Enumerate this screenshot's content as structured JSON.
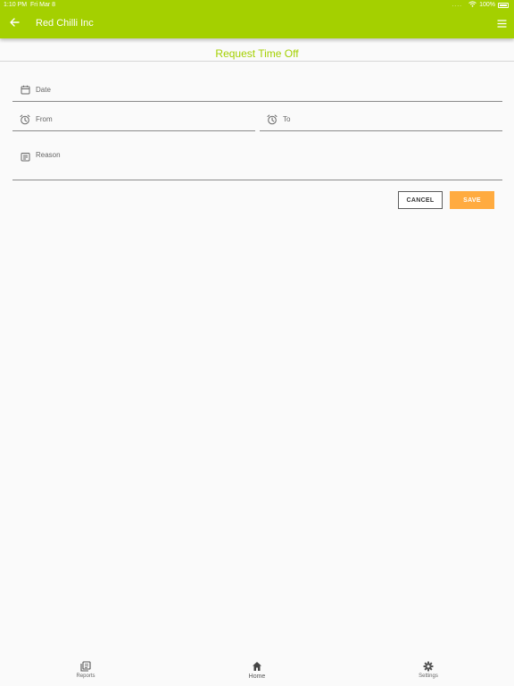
{
  "status_bar": {
    "time": "1:10 PM",
    "date": "Fri Mar 8",
    "dots": "....",
    "battery": "100%"
  },
  "app_bar": {
    "title": "Red Chilli Inc",
    "back_icon": "arrow-left-icon",
    "menu_icon": "hamburger-menu-icon",
    "color": "#a4d000"
  },
  "page": {
    "title": "Request Time Off",
    "title_color": "#a4d000"
  },
  "form": {
    "date_label": "Date",
    "from_label": "From",
    "to_label": "To",
    "reason_label": "Reason"
  },
  "actions": {
    "cancel_label": "CANCEL",
    "save_label": "SAVE",
    "save_color": "#ffab40"
  },
  "bottom_nav": {
    "tabs": [
      {
        "label": "Reports",
        "icon": "reports-icon"
      },
      {
        "label": "Home",
        "icon": "home-icon"
      },
      {
        "label": "Settings",
        "icon": "gear-icon"
      }
    ]
  }
}
